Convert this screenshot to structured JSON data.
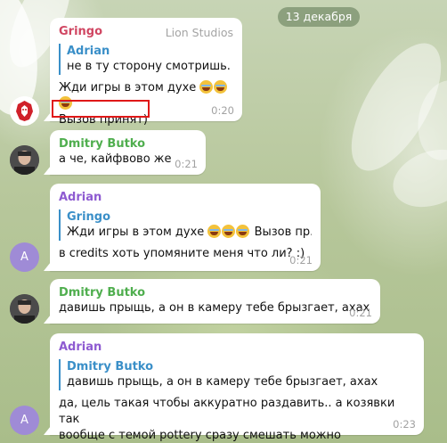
{
  "date_separator": "13 декабря",
  "messages": [
    {
      "sender": "Gringo",
      "admin_title": "Lion Studios",
      "reply": {
        "name": "Adrian",
        "text": "не в ту сторону смотришь. Д..."
      },
      "text": "Жди игры в этом духе",
      "text2": "Вызов принят)",
      "time": "0:20",
      "avatar_icon": "lion-logo-icon"
    },
    {
      "sender": "Dmitry Butko",
      "text": "а че, кайфвово же",
      "time": "0:21"
    },
    {
      "sender": "Adrian",
      "reply": {
        "name": "Gringo",
        "text_before": "Жди игры в этом духе",
        "text_after": "Вызов пр..."
      },
      "text": "в credits хоть упомяните меня что ли? :)",
      "time": "0:21",
      "avatar_letter": "A"
    },
    {
      "sender": "Dmitry Butko",
      "text": "давишь прыщь, а он в камеру тебе брызгает, ахах",
      "time": "0:21"
    },
    {
      "sender": "Adrian",
      "reply": {
        "name": "Dmitry Butko",
        "text": "давишь прыщь, а он в камеру тебе брызгает, ахах"
      },
      "text": "да, цель такая чтобы аккуратно раздавить.. а козявки так",
      "text_line2": "вообще с темой pottery сразу смешать можно",
      "time": "0:23",
      "avatar_letter": "A"
    }
  ],
  "colors": {
    "gringo": "#d04662",
    "dmitry": "#4fae4e",
    "adrian": "#8e5bd1",
    "reply_accent": "#3a8fc8",
    "highlight_box": "#e01818"
  }
}
